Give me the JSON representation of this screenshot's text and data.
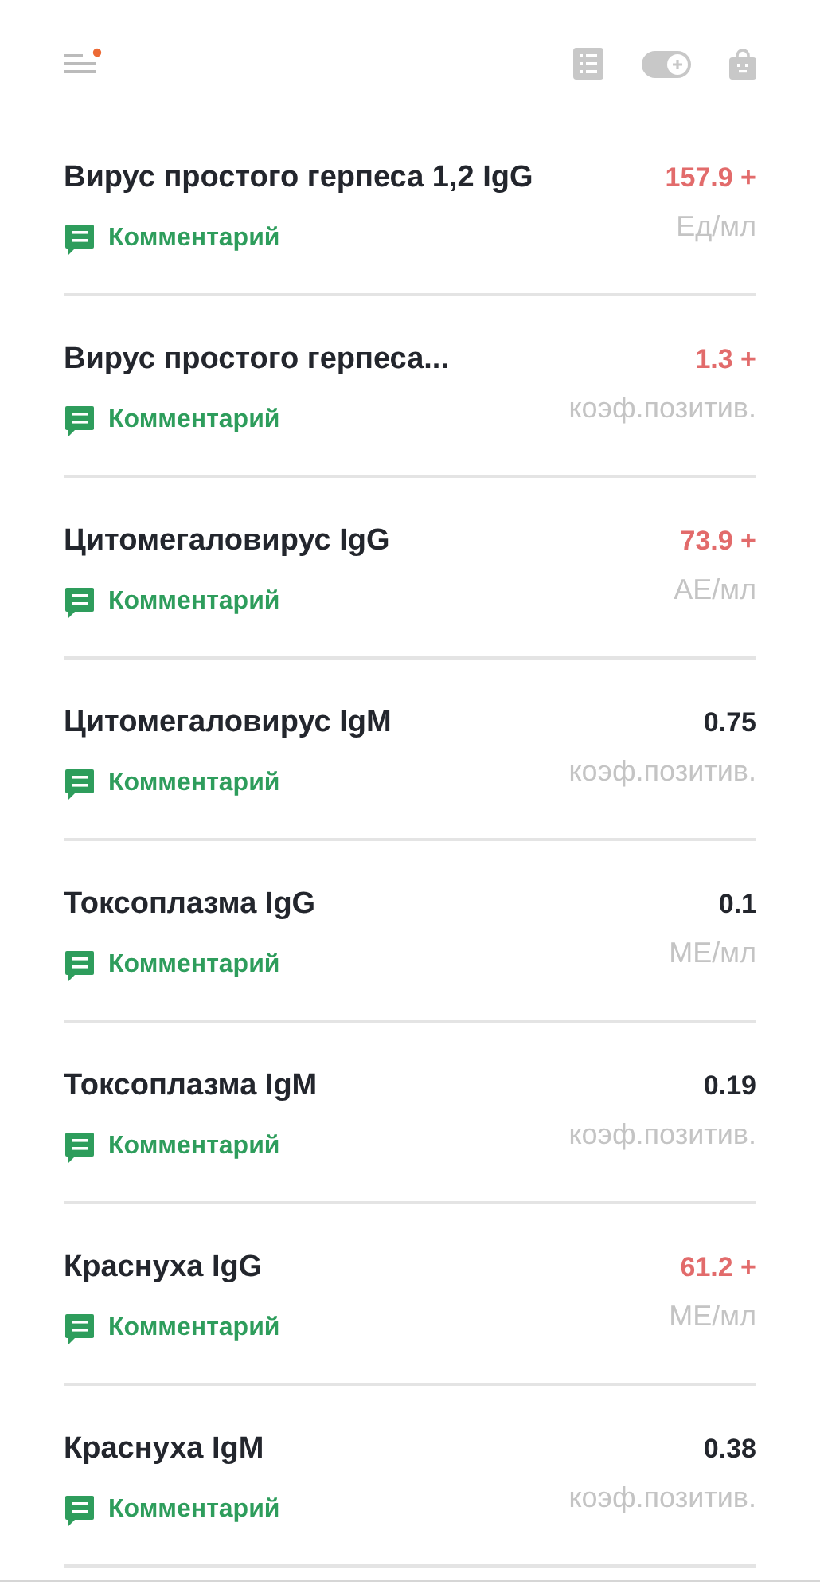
{
  "header": {
    "menu_notification": true
  },
  "results": [
    {
      "name": "Вирус простого герпеса 1,2 IgG",
      "comment": "Комментарий",
      "value": "157.9 +",
      "abnormal": true,
      "unit": "Ед/мл"
    },
    {
      "name": "Вирус простого герпеса...",
      "comment": "Комментарий",
      "value": "1.3 +",
      "abnormal": true,
      "unit": "коэф.позитив."
    },
    {
      "name": "Цитомегаловирус IgG",
      "comment": "Комментарий",
      "value": "73.9 +",
      "abnormal": true,
      "unit": "АЕ/мл"
    },
    {
      "name": "Цитомегаловирус IgM",
      "comment": "Комментарий",
      "value": "0.75",
      "abnormal": false,
      "unit": "коэф.позитив."
    },
    {
      "name": "Токсоплазма IgG",
      "comment": "Комментарий",
      "value": "0.1",
      "abnormal": false,
      "unit": "МЕ/мл"
    },
    {
      "name": "Токсоплазма IgM",
      "comment": "Комментарий",
      "value": "0.19",
      "abnormal": false,
      "unit": "коэф.позитив."
    },
    {
      "name": "Краснуха IgG",
      "comment": "Комментарий",
      "value": "61.2 +",
      "abnormal": true,
      "unit": "МЕ/мл"
    },
    {
      "name": "Краснуха IgM",
      "comment": "Комментарий",
      "value": "0.38",
      "abnormal": false,
      "unit": "коэф.позитив."
    }
  ]
}
